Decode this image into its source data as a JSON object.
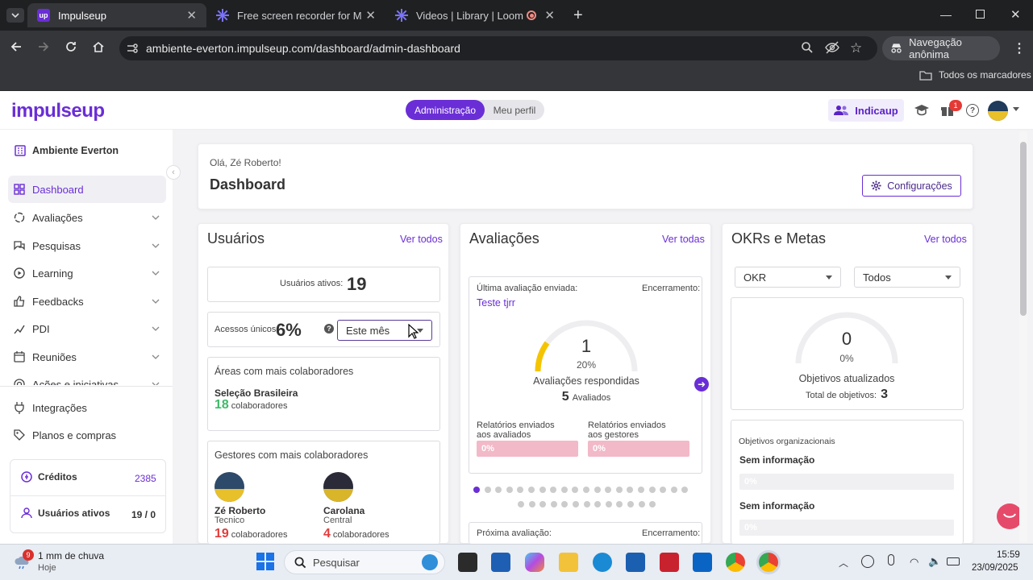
{
  "browser": {
    "tabs": [
      {
        "title": "Impulseup",
        "favicon_color": "#6a2ed6"
      },
      {
        "title": "Free screen recorder for Mac ar",
        "favicon_color": "#625df5"
      },
      {
        "title": "Videos | Library | Loom",
        "favicon_color": "#625df5"
      }
    ],
    "url": "ambiente-everton.impulseup.com/dashboard/admin-dashboard",
    "incognito_label": "Navegação anônima",
    "bookmarks_label": "Todos os marcadores"
  },
  "app": {
    "logo": "impulseup",
    "toggle": {
      "admin": "Administração",
      "perfil": "Meu perfil"
    },
    "indicaup": "Indicaup",
    "gift_badge": "1",
    "accent": "#6a2ed6"
  },
  "sidebar": {
    "workspace": "Ambiente Everton",
    "items": [
      {
        "label": "Dashboard"
      },
      {
        "label": "Avaliações"
      },
      {
        "label": "Pesquisas"
      },
      {
        "label": "Learning"
      },
      {
        "label": "Feedbacks"
      },
      {
        "label": "PDI"
      },
      {
        "label": "Reuniões"
      },
      {
        "label": "Ações e iniciativas"
      },
      {
        "label": "Integrações"
      },
      {
        "label": "Planos e compras"
      }
    ],
    "credits": {
      "label": "Créditos",
      "value": "2385"
    },
    "active_users": {
      "label": "Usuários ativos",
      "value": "19 / 0"
    }
  },
  "header": {
    "greeting": "Olá, Zé Roberto!",
    "title": "Dashboard",
    "config_label": "Configurações"
  },
  "usuarios": {
    "title": "Usuários",
    "see_all": "Ver todos",
    "active_label": "Usuários ativos:",
    "active_value": "19",
    "access_label": "Acessos únicos:",
    "access_value": "6%",
    "period": "Este mês",
    "areas_title": "Áreas com mais colaboradores",
    "area_name": "Seleção Brasileira",
    "area_count": "18",
    "collab_word": "colaboradores",
    "managers_title": "Gestores com mais colaboradores",
    "managers": [
      {
        "name": "Zé Roberto",
        "role": "Tecnico",
        "count": "19"
      },
      {
        "name": "Carolana",
        "role": "Central",
        "count": "4"
      }
    ]
  },
  "avaliacoes": {
    "title": "Avaliações",
    "see_all": "Ver todas",
    "last_label": "Última avaliação enviada:",
    "closing_label": "Encerramento:",
    "eval_name": "Teste tjrr",
    "gauge_value": "1",
    "gauge_percent": "20%",
    "gauge_fraction": 0.2,
    "answered_label": "Avaliações respondidas",
    "evaluated_count": "5",
    "evaluated_label": "Avaliados",
    "reports_evaluated": "Relatórios enviados aos avaliados",
    "reports_managers": "Relatórios enviados aos gestores",
    "reports_evaluated_value": "0%",
    "reports_managers_value": "0%",
    "next_label": "Próxima avaliação:",
    "next_closing_label": "Encerramento:"
  },
  "okrs": {
    "title": "OKRs e Metas",
    "see_all": "Ver todos",
    "filter_type": "OKR",
    "filter_scope": "Todos",
    "gauge_value": "0",
    "gauge_percent": "0%",
    "updated_label": "Objetivos atualizados",
    "total_label": "Total de objetivos:",
    "total_value": "3",
    "org_title": "Objetivos organizacionais",
    "items": [
      {
        "label": "Sem informação",
        "value": "0%"
      },
      {
        "label": "Sem informação",
        "value": "0%"
      }
    ]
  },
  "taskbar": {
    "weather": "1 mm de chuva",
    "weather_sub": "Hoje",
    "weather_badge": "9",
    "search": "Pesquisar",
    "time": "15:59",
    "date": "23/09/2025"
  }
}
